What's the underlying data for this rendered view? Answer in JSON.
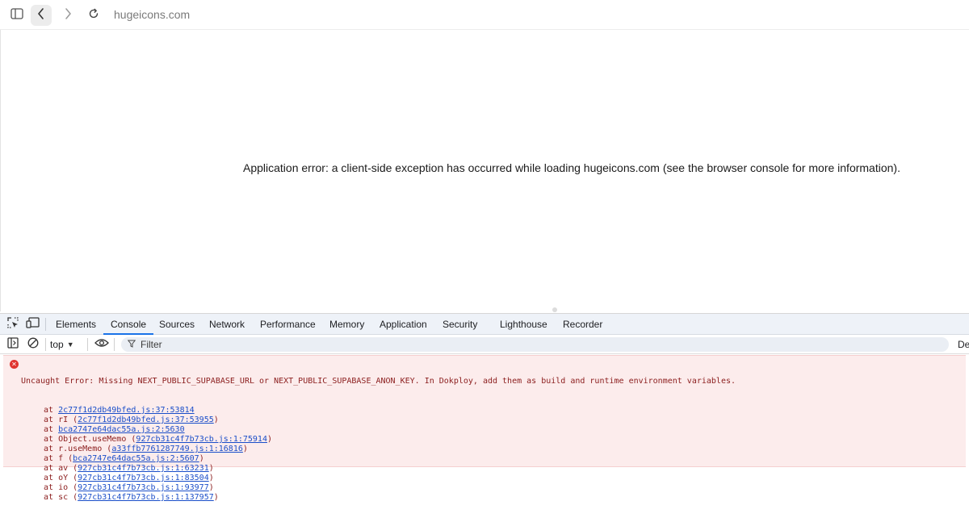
{
  "browser": {
    "address": "hugeicons.com",
    "icons": {
      "sidebar": "sidebar-icon",
      "back": "chevron-left-icon",
      "forward": "chevron-right-icon",
      "reload": "reload-icon"
    }
  },
  "page": {
    "error_message": "Application error: a client-side exception has occurred while loading hugeicons.com (see the browser console for more information)."
  },
  "devtools": {
    "tabs": [
      {
        "label": "Elements"
      },
      {
        "label": "Console",
        "active": true
      },
      {
        "label": "Sources"
      },
      {
        "label": "Network"
      },
      {
        "label": "Performance"
      },
      {
        "label": "Memory"
      },
      {
        "label": "Application"
      },
      {
        "label": "Security"
      },
      {
        "label": "Lighthouse"
      },
      {
        "label": "Recorder"
      }
    ],
    "context": "top",
    "filter_placeholder": "Filter",
    "levels_label": "De",
    "accent_color": "#1a73e8"
  },
  "console": {
    "error_color": "#e0342f",
    "error": {
      "message": "Uncaught Error: Missing NEXT_PUBLIC_SUPABASE_URL or NEXT_PUBLIC_SUPABASE_ANON_KEY. In Dokploy, add them as build and runtime environment variables.",
      "stack": [
        {
          "prefix": "at ",
          "fn": "",
          "link": "2c77f1d2db49bfed.js:37:53814",
          "paren": false
        },
        {
          "prefix": "at ",
          "fn": "rI",
          "link": "2c77f1d2db49bfed.js:37:53955",
          "paren": true
        },
        {
          "prefix": "at ",
          "fn": "",
          "link": "bca2747e64dac55a.js:2:5630",
          "paren": false
        },
        {
          "prefix": "at ",
          "fn": "Object.useMemo",
          "link": "927cb31c4f7b73cb.js:1:75914",
          "paren": true
        },
        {
          "prefix": "at ",
          "fn": "r.useMemo",
          "link": "a33ffb7761287749.js:1:16816",
          "paren": true
        },
        {
          "prefix": "at ",
          "fn": "f",
          "link": "bca2747e64dac55a.js:2:5607",
          "paren": true
        },
        {
          "prefix": "at ",
          "fn": "av",
          "link": "927cb31c4f7b73cb.js:1:63231",
          "paren": true
        },
        {
          "prefix": "at ",
          "fn": "oY",
          "link": "927cb31c4f7b73cb.js:1:83504",
          "paren": true
        },
        {
          "prefix": "at ",
          "fn": "io",
          "link": "927cb31c4f7b73cb.js:1:93977",
          "paren": true
        },
        {
          "prefix": "at ",
          "fn": "sc",
          "link": "927cb31c4f7b73cb.js:1:137957",
          "paren": true
        }
      ]
    }
  }
}
